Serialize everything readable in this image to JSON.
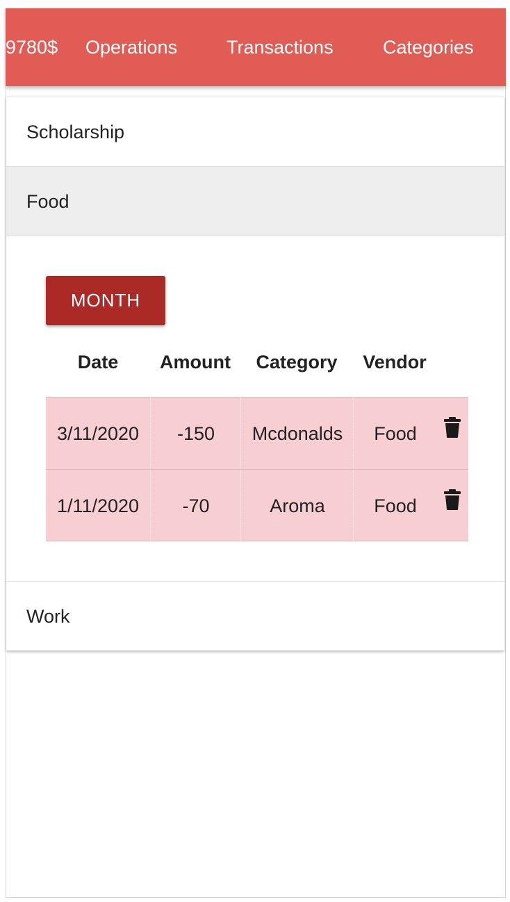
{
  "navbar": {
    "balance": "9780$",
    "items": [
      "Operations",
      "Transactions",
      "Categories"
    ],
    "color": "#e05c55"
  },
  "categories": [
    {
      "label": "Scholarship"
    },
    {
      "label": "Food"
    },
    {
      "label": "Work"
    }
  ],
  "expanded": {
    "month_button": "MONTH",
    "button_color": "#ab2a25",
    "row_color": "#f7cfd2",
    "columns": [
      "Date",
      "Amount",
      "Category",
      "Vendor"
    ],
    "rows": [
      {
        "date": "3/11/2020",
        "amount": "-150",
        "category": "Mcdonalds",
        "vendor": "Food",
        "action_icon": "trash-icon"
      },
      {
        "date": "1/11/2020",
        "amount": "-70",
        "category": "Aroma",
        "vendor": "Food",
        "action_icon": "trash-icon"
      }
    ]
  }
}
